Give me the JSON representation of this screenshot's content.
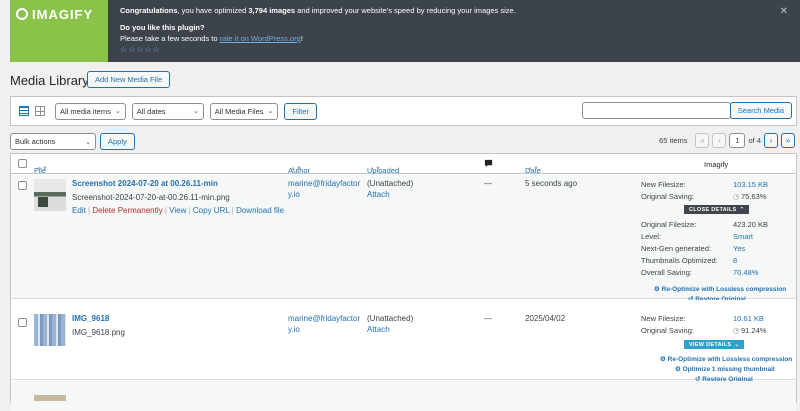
{
  "notice": {
    "logo": "IMAGIFY",
    "congrats_prefix": "Congratulations",
    "congrats_mid": ", you have optimized ",
    "congrats_count": "3,794 images",
    "congrats_suffix": " and improved your website's speed by reducing your images size.",
    "question": "Do you like this plugin?",
    "ask_prefix": "Please take a few seconds to ",
    "ask_link": "rate it on WordPress.org",
    "ask_suffix": "!",
    "stars": "☆☆☆☆☆",
    "close": "✕"
  },
  "page_title": "Media Library",
  "add_new_label": "Add New Media File",
  "filters": {
    "media_items": "All media items",
    "dates": "All dates",
    "media_files": "All Media Files",
    "filter_label": "Filter",
    "search_label": "Search Media"
  },
  "bulk": {
    "action": "Bulk actions",
    "apply": "Apply"
  },
  "pagination": {
    "count": "65 items",
    "first": "«",
    "prev": "‹",
    "current": "1",
    "of": "of 4",
    "next": "›",
    "last": "»"
  },
  "columns": {
    "file": "File",
    "author": "Author",
    "uploaded_to": "Uploaded to",
    "comments_icon": "comment-bubble",
    "date": "Date",
    "imagify": "Imagify"
  },
  "rows": [
    {
      "title": "Screenshot 2024-07-20 at 00.26.11-min",
      "filename": "Screenshot-2024-07-20-at-00.26.11-min.png",
      "actions": {
        "edit": "Edit",
        "delete": "Delete Permanently",
        "view": "View",
        "copy": "Copy URL",
        "download": "Download file"
      },
      "author_line1": "marine@fridayfactor",
      "author_line2": "y.io",
      "uploaded": "(Unattached)",
      "attach": "Attach",
      "comments": "—",
      "date": "5 seconds ago",
      "imagify": {
        "new_filesize_label": "New Filesize:",
        "new_filesize": "103.15 KB",
        "saving_label": "Original Saving:",
        "saving": "75.63%",
        "details_btn": "CLOSE DETAILS",
        "original_filesize_label": "Original Filesize:",
        "original_filesize": "423.20 KB",
        "level_label": "Level:",
        "level": "Smart",
        "nextgen_label": "Next-Gen generated:",
        "nextgen": "Yes",
        "thumbs_label": "Thumbnails Optimized:",
        "thumbs": "8",
        "overall_label": "Overall Saving:",
        "overall": "70.48%",
        "reoptimize": "Re-Optimize with Lossless compression",
        "restore": "Restore Original"
      }
    },
    {
      "title": "IMG_9618",
      "filename": "IMG_9618.png",
      "author_line1": "marine@fridayfactor",
      "author_line2": "y.io",
      "uploaded": "(Unattached)",
      "attach": "Attach",
      "comments": "—",
      "date": "2025/04/02",
      "imagify": {
        "new_filesize_label": "New Filesize:",
        "new_filesize": "10.61 KB",
        "saving_label": "Original Saving:",
        "saving": "91.24%",
        "details_btn": "VIEW DETAILS",
        "reoptimize": "Re-Optimize with Lossless compression",
        "optimize_thumb": "Optimize 1 missing thumbnail",
        "restore": "Restore Original"
      }
    }
  ]
}
